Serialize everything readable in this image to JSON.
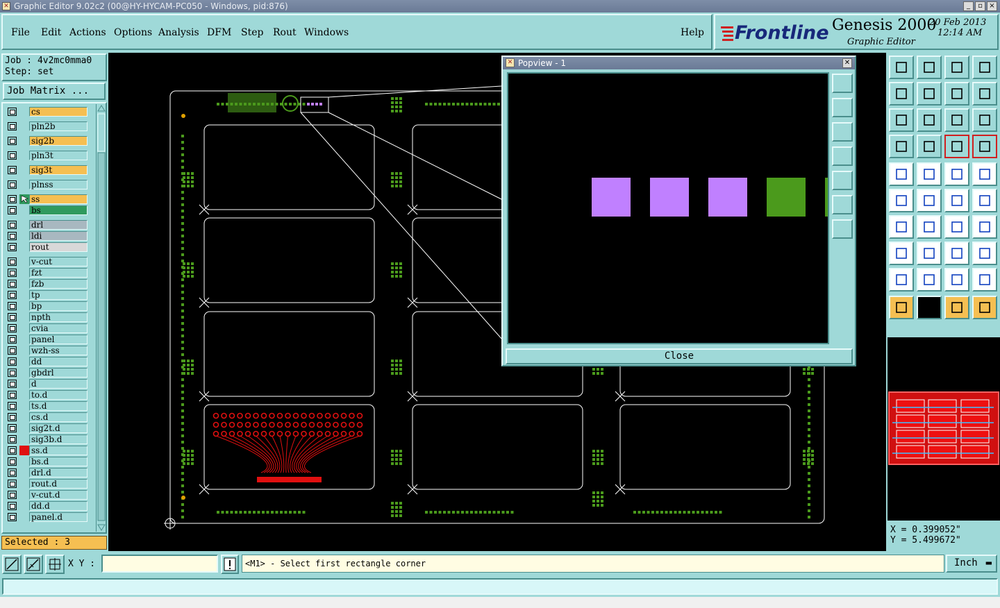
{
  "window": {
    "title": "Graphic Editor 9.02c2 (00@HY-HYCAM-PC050 - Windows, pid:876)",
    "buttons": [
      "_",
      "▫",
      "×"
    ]
  },
  "menu": [
    "File",
    "Edit",
    "Actions",
    "Options",
    "Analysis",
    "DFM",
    "Step",
    "Rout",
    "Windows"
  ],
  "help_label": "Help",
  "brand": {
    "logo": "Frontline",
    "product": "Genesis 2000",
    "subtitle": "Graphic Editor",
    "date": "20 Feb 2013",
    "time": "12:14 AM"
  },
  "job": {
    "job_line": "Job : 4v2mc0mma0",
    "step_line": "Step: set",
    "matrix_button": "Job Matrix ..."
  },
  "layers": [
    {
      "name": "cs",
      "color": "#f5bf52"
    },
    {
      "name": "pln2b",
      "color": "#9fd9d8"
    },
    {
      "name": "sig2b",
      "color": "#f5bf52"
    },
    {
      "name": "pln3t",
      "color": "#9fd9d8"
    },
    {
      "name": "sig3t",
      "color": "#f5bf52"
    },
    {
      "name": "plnss",
      "color": "#9fd9d8"
    },
    {
      "name": "ss",
      "color": "#f5bf52",
      "active": true
    },
    {
      "name": "bs",
      "color": "#2f9a5e"
    },
    {
      "name": "drl",
      "color": "#a8b8c0"
    },
    {
      "name": "ldi",
      "color": "#a8b8c0"
    },
    {
      "name": "rout",
      "color": "#d8d8d8"
    },
    {
      "name": "v-cut",
      "color": "#9fd9d8"
    },
    {
      "name": "fzt",
      "color": "#9fd9d8"
    },
    {
      "name": "fzb",
      "color": "#9fd9d8"
    },
    {
      "name": "tp",
      "color": "#9fd9d8"
    },
    {
      "name": "bp",
      "color": "#9fd9d8"
    },
    {
      "name": "npth",
      "color": "#9fd9d8"
    },
    {
      "name": "cvia",
      "color": "#9fd9d8"
    },
    {
      "name": "panel",
      "color": "#9fd9d8"
    },
    {
      "name": "wzh-ss",
      "color": "#9fd9d8"
    },
    {
      "name": "dd",
      "color": "#9fd9d8"
    },
    {
      "name": "gbdrl",
      "color": "#9fd9d8"
    },
    {
      "name": "d",
      "color": "#9fd9d8"
    },
    {
      "name": "to.d",
      "color": "#9fd9d8"
    },
    {
      "name": "ts.d",
      "color": "#9fd9d8"
    },
    {
      "name": "cs.d",
      "color": "#9fd9d8"
    },
    {
      "name": "sig2t.d",
      "color": "#9fd9d8"
    },
    {
      "name": "sig3b.d",
      "color": "#9fd9d8"
    },
    {
      "name": "ss.d",
      "color": "#9fd9d8",
      "swatch": "#e01010"
    },
    {
      "name": "bs.d",
      "color": "#9fd9d8"
    },
    {
      "name": "drl.d",
      "color": "#9fd9d8"
    },
    {
      "name": "rout.d",
      "color": "#9fd9d8"
    },
    {
      "name": "v-cut.d",
      "color": "#9fd9d8"
    },
    {
      "name": "dd.d",
      "color": "#9fd9d8"
    },
    {
      "name": "panel.d",
      "color": "#9fd9d8"
    }
  ],
  "selected": "Selected : 3",
  "popview": {
    "title": "Popview - 1",
    "close_label": "Close"
  },
  "coords": {
    "x": "X = 0.399052\"",
    "y": "Y = 5.499672\""
  },
  "command": {
    "xy_label": "X Y :",
    "xy_value": "",
    "message": "<M1> - Select first rectangle corner",
    "unit": "Inch"
  },
  "colors": {
    "accent": "#9fd9d8",
    "canvas": "#000000",
    "pcb_green": "#4b9a1c",
    "pcb_red": "#e01010",
    "highlight": "#c080ff"
  }
}
